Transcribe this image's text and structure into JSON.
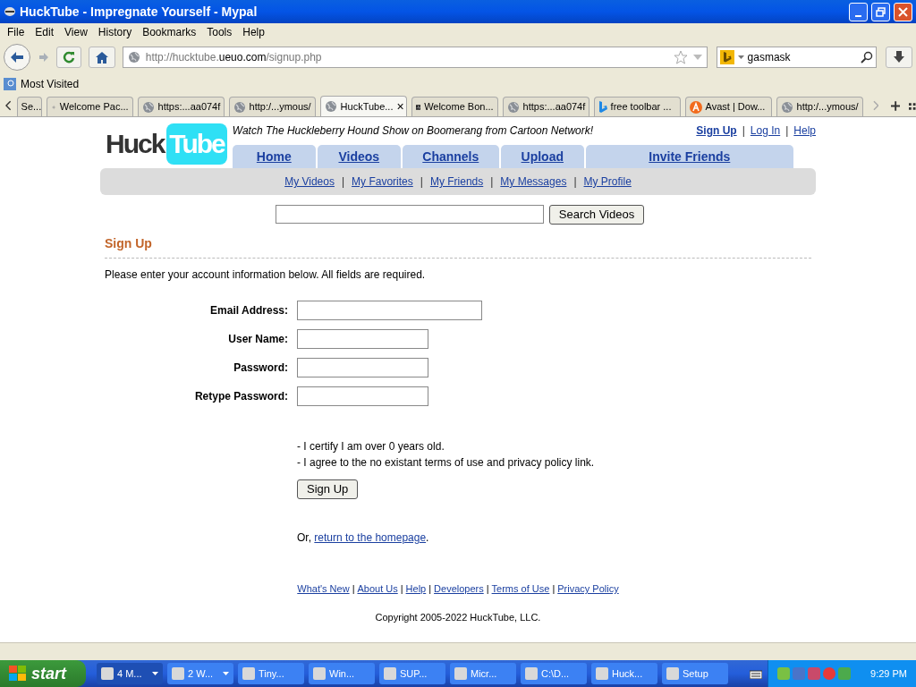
{
  "window": {
    "title": "HuckTube - Impregnate Yourself - Mypal"
  },
  "menu": [
    "File",
    "Edit",
    "View",
    "History",
    "Bookmarks",
    "Tools",
    "Help"
  ],
  "address": {
    "prefix": "http://hucktube.",
    "domain": "ueuo.com",
    "suffix": "/signup.php"
  },
  "search": {
    "value": "gasmask"
  },
  "bookmarks": [
    "Most Visited"
  ],
  "tabs": [
    {
      "title": "Se...",
      "selected": false,
      "kind": "plain"
    },
    {
      "title": "Welcome Pac...",
      "selected": false,
      "kind": "star"
    },
    {
      "title": "https:...aa074f",
      "selected": false,
      "kind": "globe"
    },
    {
      "title": "http:/...ymous/",
      "selected": false,
      "kind": "globe"
    },
    {
      "title": "HuckTube...",
      "selected": true,
      "kind": "globe",
      "close": "×"
    },
    {
      "title": "Welcome Bon...",
      "selected": false,
      "kind": "dark"
    },
    {
      "title": "https:...aa074f",
      "selected": false,
      "kind": "globe"
    },
    {
      "title": "free toolbar ...",
      "selected": false,
      "kind": "bing"
    },
    {
      "title": "Avast | Dow...",
      "selected": false,
      "kind": "avast"
    },
    {
      "title": "http:/...ymous/",
      "selected": false,
      "kind": "globe"
    }
  ],
  "page": {
    "logo": {
      "left": "Huck",
      "right": "Tube"
    },
    "tagline": "Watch The Huckleberry Hound Show on Boomerang from Cartoon Network!",
    "top_links": [
      "Sign Up",
      "Log In",
      "Help"
    ],
    "separator": "|",
    "nav": [
      {
        "label": "Home"
      },
      {
        "label": "Videos"
      },
      {
        "label": "Channels"
      },
      {
        "label": "Upload"
      },
      {
        "label": "Invite Friends"
      }
    ],
    "subnav": [
      "My Videos",
      "My Favorites",
      "My Friends",
      "My Messages",
      "My Profile"
    ],
    "search_button": "Search Videos",
    "heading": "Sign Up",
    "intro": "Please enter your account information below. All fields are required.",
    "fields": [
      {
        "label": "Email Address:",
        "wide": true
      },
      {
        "label": "User Name:",
        "wide": false
      },
      {
        "label": "Password:",
        "wide": false
      },
      {
        "label": "Retype Password:",
        "wide": false
      }
    ],
    "terms": [
      "- I certify I am over 0 years old.",
      "- I agree to the no existant terms of use and privacy policy link."
    ],
    "submit": "Sign Up",
    "alt": {
      "before": "Or, ",
      "link": "return to the homepage",
      "after": "."
    },
    "footer_links": [
      "What's New",
      "About Us",
      "Help",
      "Developers",
      "Terms of Use",
      "Privacy Policy"
    ],
    "copyright": "Copyright 2005-2022 HuckTube, LLC."
  },
  "taskbar": {
    "start": "start",
    "buttons": [
      {
        "label": "4 M...",
        "menu": true,
        "active": true
      },
      {
        "label": "2 W...",
        "menu": true,
        "active": false
      },
      {
        "label": "Tiny...",
        "menu": false,
        "active": false
      },
      {
        "label": "Win...",
        "menu": false,
        "active": false
      },
      {
        "label": "SUP...",
        "menu": false,
        "active": false
      },
      {
        "label": "Micr...",
        "menu": false,
        "active": false
      },
      {
        "label": "C:\\D...",
        "menu": false,
        "active": false
      },
      {
        "label": "Huck...",
        "menu": false,
        "active": false
      },
      {
        "label": "Setup",
        "menu": false,
        "active": false
      }
    ],
    "time": "9:29 PM"
  }
}
